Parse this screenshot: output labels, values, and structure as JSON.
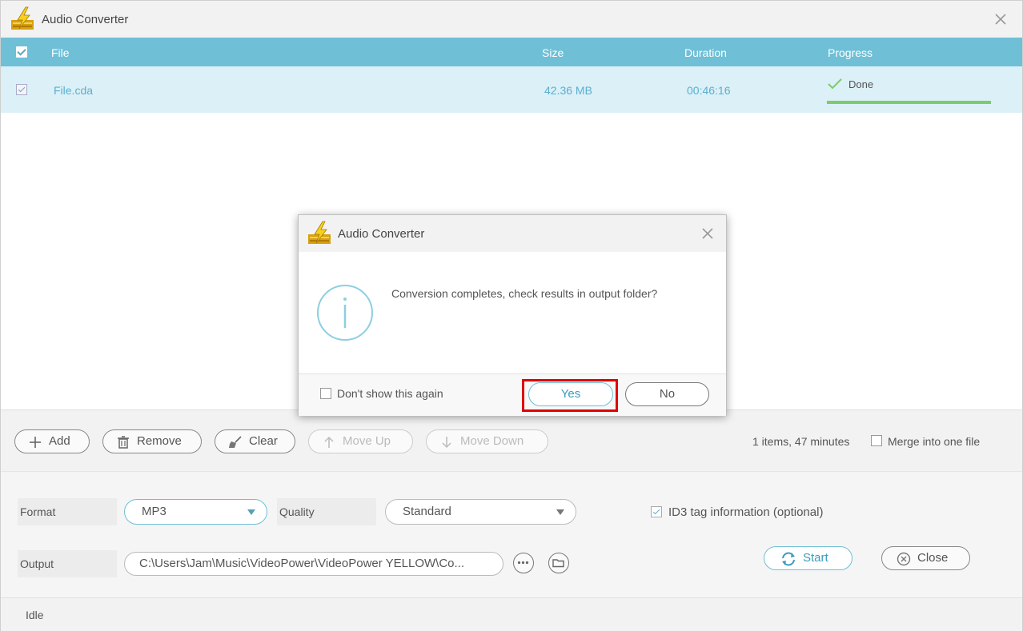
{
  "window": {
    "title": "Audio Converter",
    "icons": {
      "logo": "lightning-logo-icon",
      "close": "close-icon"
    }
  },
  "table": {
    "headers": {
      "file": "File",
      "size": "Size",
      "duration": "Duration",
      "progress": "Progress"
    },
    "rows": [
      {
        "file": "File.cda",
        "size": "42.36 MB",
        "duration": "00:46:16",
        "status": "Done",
        "progress": 1.0
      }
    ]
  },
  "toolbar": {
    "add": "Add",
    "remove": "Remove",
    "clear": "Clear",
    "move_up": "Move Up",
    "move_down": "Move Down",
    "items_info": "1 items, 47 minutes",
    "merge_label": "Merge into one file"
  },
  "settings": {
    "format_label": "Format",
    "format_value": "MP3",
    "quality_label": "Quality",
    "quality_value": "Standard",
    "id3_label": "ID3 tag information (optional)",
    "output_label": "Output",
    "output_path": "C:\\Users\\Jam\\Music\\VideoPower\\VideoPower YELLOW\\Co...",
    "start": "Start",
    "close": "Close"
  },
  "status": {
    "text": "Idle"
  },
  "dialog": {
    "title": "Audio Converter",
    "message": "Conversion completes, check results in output folder?",
    "dont_show": "Don't show this again",
    "yes": "Yes",
    "no": "No"
  },
  "colors": {
    "accent": "#6fbfd6",
    "row_bg": "#dbf0f7",
    "progress": "#7dcc6b",
    "highlight": "#e00000"
  }
}
